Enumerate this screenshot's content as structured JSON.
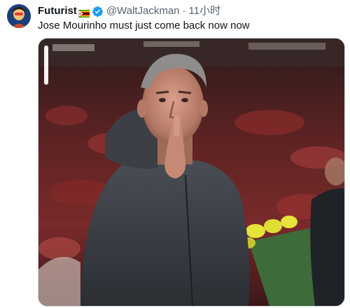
{
  "tweet": {
    "display_name": "Futurist",
    "flag_icon": "zimbabwe-flag-icon",
    "verified_icon": "verified-badge-icon",
    "handle": "@WaltJackman",
    "separator": "·",
    "time": "11小时",
    "text": "Jose Mourinho must just come back now now"
  },
  "colors": {
    "verified_blue": "#1d9bf0",
    "secondary_text": "#536471",
    "primary_text": "#0f1419"
  }
}
